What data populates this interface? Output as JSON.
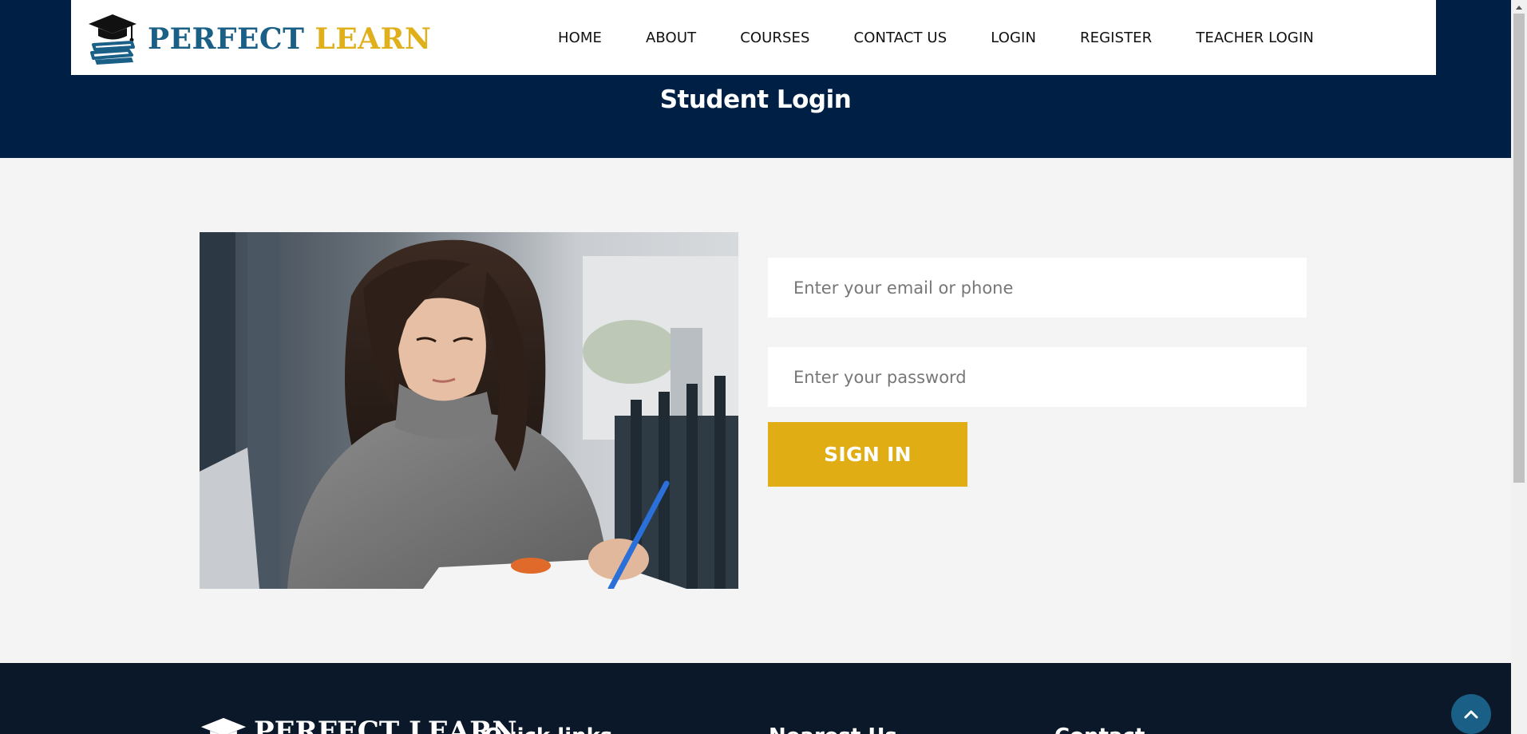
{
  "brand": {
    "name_part1": "PERFECT",
    "name_part2": "LEARN"
  },
  "nav": {
    "items": [
      {
        "label": "HOME"
      },
      {
        "label": "ABOUT"
      },
      {
        "label": "COURSES"
      },
      {
        "label": "CONTACT US"
      },
      {
        "label": "LOGIN"
      },
      {
        "label": "REGISTER"
      },
      {
        "label": "TEACHER LOGIN"
      }
    ]
  },
  "page": {
    "title": "Student Login"
  },
  "form": {
    "email_placeholder": "Enter your email or phone",
    "email_value": "",
    "password_placeholder": "Enter your password",
    "password_value": "",
    "submit_label": "SIGN IN"
  },
  "footer": {
    "logo_text": "PERFECT LEARN",
    "headings": [
      "Quick links",
      "Nearest Us",
      "Contact"
    ]
  },
  "icons": {
    "logo": "graduation-cap-books-icon",
    "back_to_top": "chevron-up-icon",
    "scroll_up": "triangle-up-icon"
  },
  "colors": {
    "hero_bg": "#001f45",
    "brand_blue": "#1a5f86",
    "brand_gold": "#e0b01c",
    "button_gold": "#e0ad14",
    "footer_bg": "#0b1829",
    "page_bg": "#f4f4f4"
  }
}
